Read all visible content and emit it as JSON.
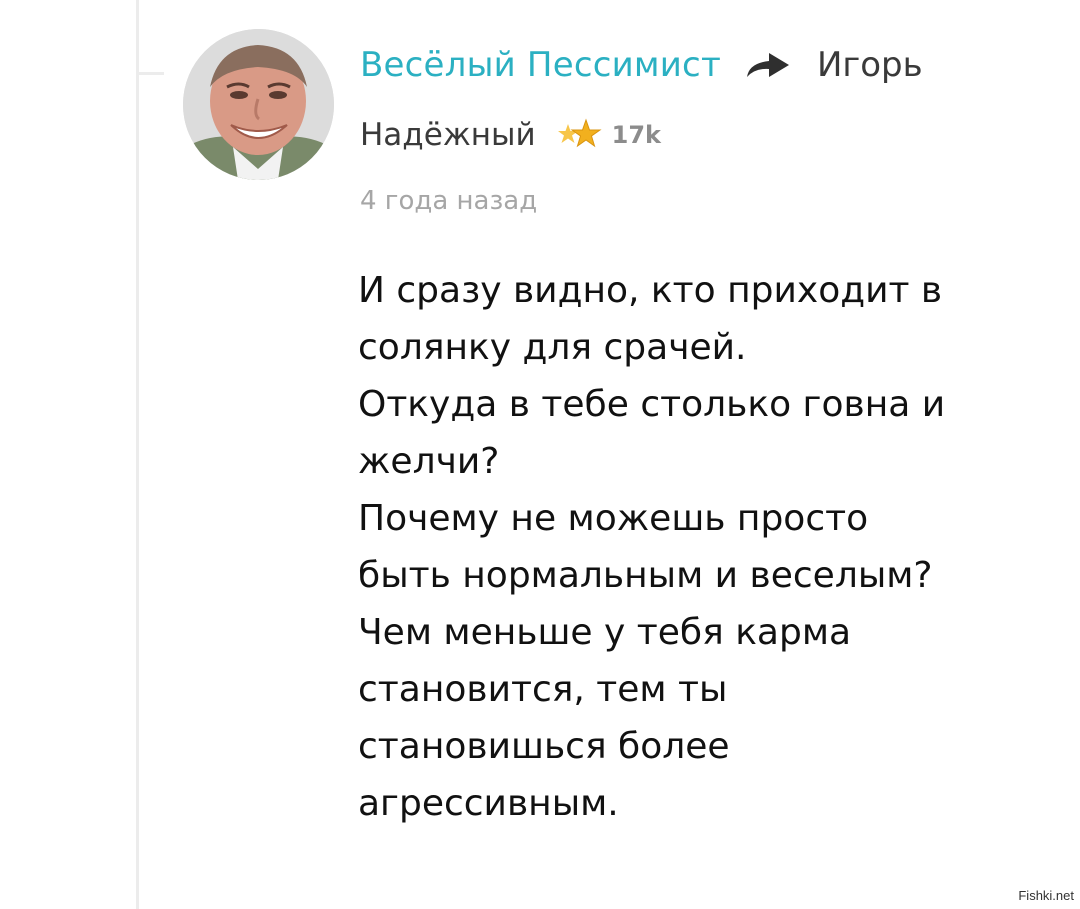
{
  "comment": {
    "author": {
      "name": "Весёлый Пессимист",
      "avatar_icon": "avatar-photo"
    },
    "reply_icon": "reply-arrow-icon",
    "reply_to": "Игорь",
    "rank": {
      "label": "Надёжный",
      "icon": "stars-icon",
      "rating": "17k"
    },
    "timestamp": "4 года назад",
    "text_lines": [
      "И сразу видно, кто приходит в",
      "солянку для срачей.",
      "Откуда в тебе столько говна и",
      "желчи?",
      "Почему не можешь просто",
      "быть нормальным и веселым?",
      "Чем меньше у тебя карма",
      "становится, тем ты",
      "становишься более",
      "агрессивным."
    ]
  },
  "watermark": "Fishki.net",
  "colors": {
    "author": "#2bb0c2",
    "reply_icon": "#2f2f2f",
    "star": "#f2b01e",
    "rating": "#8c8c8c",
    "timestamp": "#a6a6a6"
  }
}
